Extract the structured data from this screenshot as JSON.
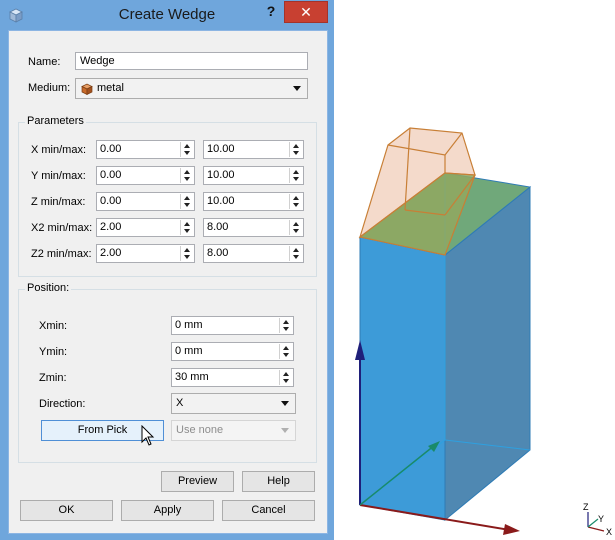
{
  "dialog": {
    "title": "Create Wedge",
    "help_label": "?",
    "close_label": "✕"
  },
  "form": {
    "name_label": "Name:",
    "name_value": "Wedge",
    "medium_label": "Medium:",
    "medium_value": "metal"
  },
  "parameters": {
    "group_title": "Parameters",
    "rows": [
      {
        "label": "X min/max:",
        "min": "0.00",
        "max": "10.00"
      },
      {
        "label": "Y min/max:",
        "min": "0.00",
        "max": "10.00"
      },
      {
        "label": "Z min/max:",
        "min": "0.00",
        "max": "10.00"
      },
      {
        "label": "X2 min/max:",
        "min": "2.00",
        "max": "8.00"
      },
      {
        "label": "Z2 min/max:",
        "min": "2.00",
        "max": "8.00"
      }
    ]
  },
  "position": {
    "group_title": "Position:",
    "xmin_label": "Xmin:",
    "xmin_value": "0 mm",
    "ymin_label": "Ymin:",
    "ymin_value": "0 mm",
    "zmin_label": "Zmin:",
    "zmin_value": "30 mm",
    "direction_label": "Direction:",
    "direction_value": "X",
    "from_pick_label": "From Pick",
    "use_none_value": "Use none"
  },
  "buttons": {
    "preview": "Preview",
    "help": "Help",
    "ok": "OK",
    "apply": "Apply",
    "cancel": "Cancel"
  },
  "viewport": {
    "axis_z": "Z",
    "axis_y": "Y",
    "axis_x": "X"
  },
  "colors": {
    "title_bar": "#6fa6dc",
    "close_button": "#c84031",
    "box_fill": "#3f9fd9",
    "wedge_fill": "#f2d3c2",
    "wedge_edge": "#c87f36",
    "axis_z_arrow": "#1f1f7a",
    "axis_x_arrow": "#8a1a1a",
    "axis_y_arrow": "#1a8a6a"
  }
}
